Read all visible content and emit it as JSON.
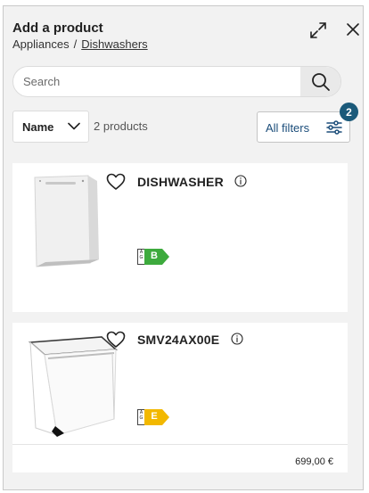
{
  "header": {
    "title": "Add a product",
    "breadcrumb": [
      "Appliances",
      "Dishwashers"
    ],
    "breadcrumb_separator": "/",
    "icons": [
      "expand-icon",
      "close-icon"
    ]
  },
  "search": {
    "placeholder": "Search",
    "value": "",
    "icon": "search-icon"
  },
  "toolbar": {
    "sort_value": "Name",
    "product_count": "2 products",
    "filters_label": "All filters",
    "filters_badge": "2",
    "filters_icon": "sliders-icon"
  },
  "products": [
    {
      "name": "DISHWASHER",
      "energy_scale": "A\nG",
      "energy_class": "B",
      "energy_color": "#3daa3d",
      "price": ""
    },
    {
      "name": "SMV24AX00E",
      "energy_scale": "A\nG",
      "energy_class": "E",
      "energy_color": "#f2b800",
      "price": "699,00 €"
    }
  ],
  "colors": {
    "accent": "#1b5a7a",
    "link": "#1b4d7a",
    "panel_bg": "#f2f2f2"
  }
}
